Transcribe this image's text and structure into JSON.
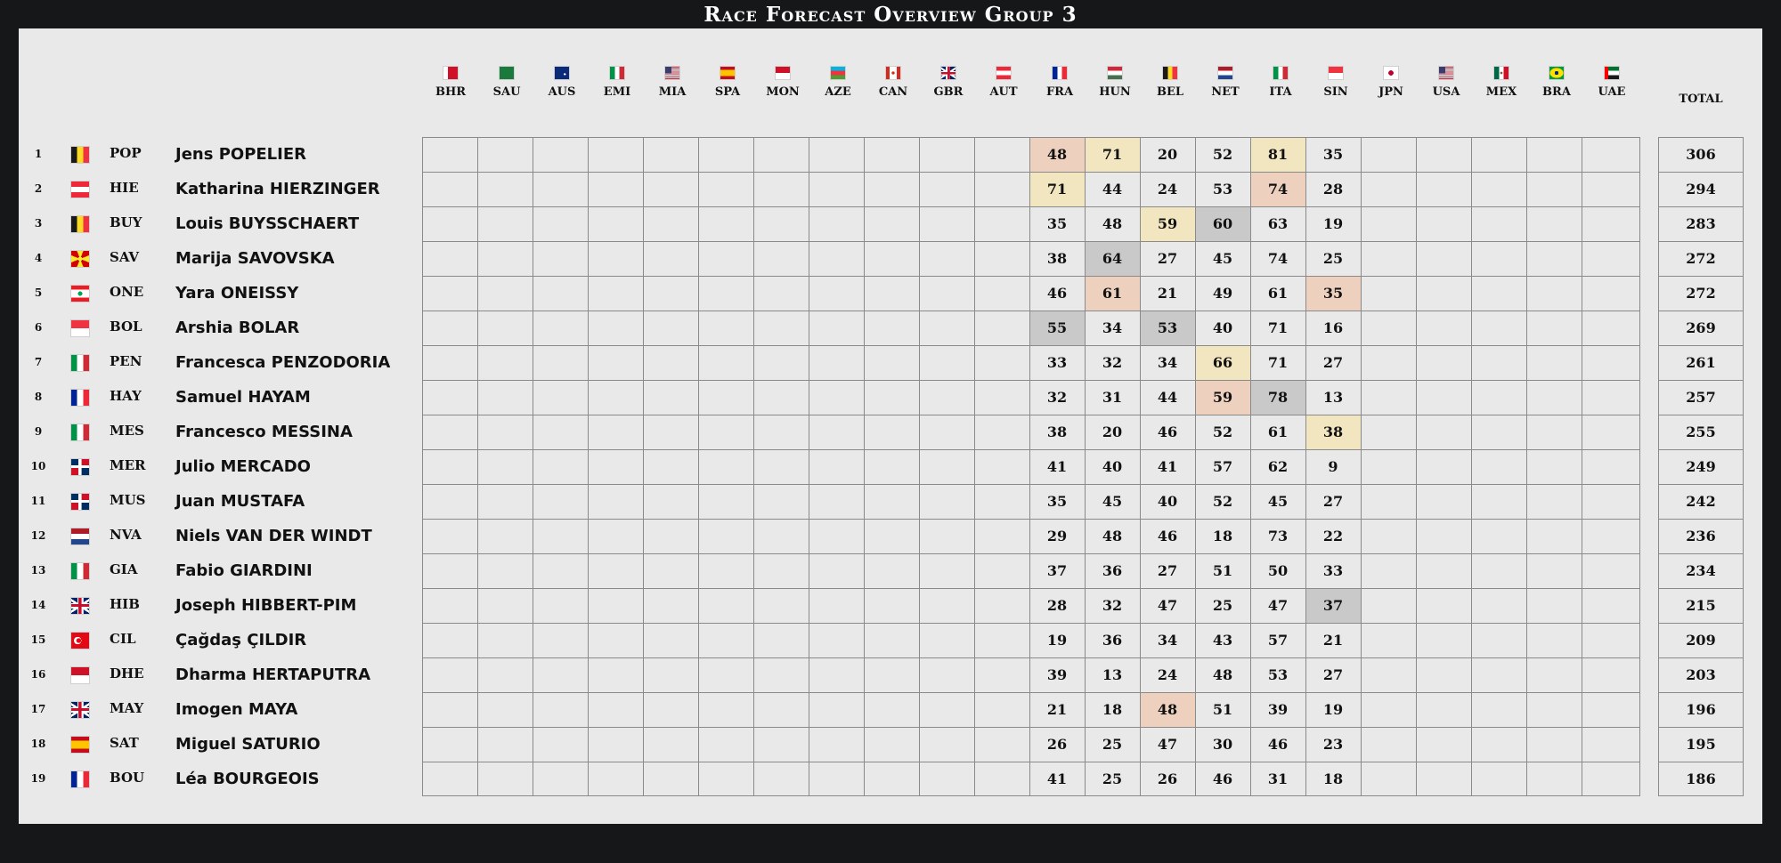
{
  "title": "Race Forecast Overview Group 3",
  "total_label": "TOTAL",
  "races": [
    {
      "code": "BHR",
      "flag": "bahrain"
    },
    {
      "code": "SAU",
      "flag": "saudi-arabia"
    },
    {
      "code": "AUS",
      "flag": "australia"
    },
    {
      "code": "EMI",
      "flag": "italy"
    },
    {
      "code": "MIA",
      "flag": "usa"
    },
    {
      "code": "SPA",
      "flag": "spain"
    },
    {
      "code": "MON",
      "flag": "monaco"
    },
    {
      "code": "AZE",
      "flag": "azerbaijan"
    },
    {
      "code": "CAN",
      "flag": "canada"
    },
    {
      "code": "GBR",
      "flag": "uk"
    },
    {
      "code": "AUT",
      "flag": "austria"
    },
    {
      "code": "FRA",
      "flag": "france"
    },
    {
      "code": "HUN",
      "flag": "hungary"
    },
    {
      "code": "BEL",
      "flag": "belgium"
    },
    {
      "code": "NET",
      "flag": "netherlands"
    },
    {
      "code": "ITA",
      "flag": "italy"
    },
    {
      "code": "SIN",
      "flag": "singapore"
    },
    {
      "code": "JPN",
      "flag": "japan"
    },
    {
      "code": "USA",
      "flag": "usa"
    },
    {
      "code": "MEX",
      "flag": "mexico"
    },
    {
      "code": "BRA",
      "flag": "brazil"
    },
    {
      "code": "UAE",
      "flag": "uae"
    }
  ],
  "highlight_colors": {
    "yellow": "#f2e6c0",
    "peach": "#edd1be",
    "grey": "#c9c9c9"
  },
  "players": [
    {
      "rank": "1",
      "flag": "belgium",
      "code": "POP",
      "name": "Jens POPELIER",
      "scores": [
        "48",
        "71",
        "20",
        "52",
        "81",
        "35"
      ],
      "highlights": [
        "peach",
        "yellow",
        "",
        "",
        "yellow",
        ""
      ],
      "total": "306"
    },
    {
      "rank": "2",
      "flag": "austria",
      "code": "HIE",
      "name": "Katharina HIERZINGER",
      "scores": [
        "71",
        "44",
        "24",
        "53",
        "74",
        "28"
      ],
      "highlights": [
        "yellow",
        "",
        "",
        "",
        "peach",
        ""
      ],
      "total": "294"
    },
    {
      "rank": "3",
      "flag": "belgium",
      "code": "BUY",
      "name": "Louis BUYSSCHAERT",
      "scores": [
        "35",
        "48",
        "59",
        "60",
        "63",
        "19"
      ],
      "highlights": [
        "",
        "",
        "yellow",
        "grey",
        "",
        ""
      ],
      "total": "283"
    },
    {
      "rank": "4",
      "flag": "macedonia",
      "code": "SAV",
      "name": "Marija SAVOVSKA",
      "scores": [
        "38",
        "64",
        "27",
        "45",
        "74",
        "25"
      ],
      "highlights": [
        "",
        "grey",
        "",
        "",
        "",
        ""
      ],
      "total": "272"
    },
    {
      "rank": "5",
      "flag": "lebanon",
      "code": "ONE",
      "name": "Yara ONEISSY",
      "scores": [
        "46",
        "61",
        "21",
        "49",
        "61",
        "35"
      ],
      "highlights": [
        "",
        "peach",
        "",
        "",
        "",
        "peach"
      ],
      "total": "272"
    },
    {
      "rank": "6",
      "flag": "singapore",
      "code": "BOL",
      "name": "Arshia BOLAR",
      "scores": [
        "55",
        "34",
        "53",
        "40",
        "71",
        "16"
      ],
      "highlights": [
        "grey",
        "",
        "grey",
        "",
        "",
        ""
      ],
      "total": "269"
    },
    {
      "rank": "7",
      "flag": "italy",
      "code": "PEN",
      "name": "Francesca PENZODORIA",
      "scores": [
        "33",
        "32",
        "34",
        "66",
        "71",
        "27"
      ],
      "highlights": [
        "",
        "",
        "",
        "yellow",
        "",
        ""
      ],
      "total": "261"
    },
    {
      "rank": "8",
      "flag": "france",
      "code": "HAY",
      "name": "Samuel HAYAM",
      "scores": [
        "32",
        "31",
        "44",
        "59",
        "78",
        "13"
      ],
      "highlights": [
        "",
        "",
        "",
        "peach",
        "grey",
        ""
      ],
      "total": "257"
    },
    {
      "rank": "9",
      "flag": "italy",
      "code": "MES",
      "name": "Francesco MESSINA",
      "scores": [
        "38",
        "20",
        "46",
        "52",
        "61",
        "38"
      ],
      "highlights": [
        "",
        "",
        "",
        "",
        "",
        "yellow"
      ],
      "total": "255"
    },
    {
      "rank": "10",
      "flag": "dominican",
      "code": "MER",
      "name": "Julio MERCADO",
      "scores": [
        "41",
        "40",
        "41",
        "57",
        "62",
        "9"
      ],
      "highlights": [
        "",
        "",
        "",
        "",
        "",
        ""
      ],
      "total": "249"
    },
    {
      "rank": "11",
      "flag": "dominican",
      "code": "MUS",
      "name": "Juan MUSTAFA",
      "scores": [
        "35",
        "45",
        "40",
        "52",
        "45",
        "27"
      ],
      "highlights": [
        "",
        "",
        "",
        "",
        "",
        ""
      ],
      "total": "242"
    },
    {
      "rank": "12",
      "flag": "netherlands",
      "code": "NVA",
      "name": "Niels VAN DER WINDT",
      "scores": [
        "29",
        "48",
        "46",
        "18",
        "73",
        "22"
      ],
      "highlights": [
        "",
        "",
        "",
        "",
        "",
        ""
      ],
      "total": "236"
    },
    {
      "rank": "13",
      "flag": "italy",
      "code": "GIA",
      "name": "Fabio GIARDINI",
      "scores": [
        "37",
        "36",
        "27",
        "51",
        "50",
        "33"
      ],
      "highlights": [
        "",
        "",
        "",
        "",
        "",
        ""
      ],
      "total": "234"
    },
    {
      "rank": "14",
      "flag": "uk",
      "code": "HIB",
      "name": "Joseph HIBBERT-PIM",
      "scores": [
        "28",
        "32",
        "47",
        "25",
        "47",
        "37"
      ],
      "highlights": [
        "",
        "",
        "",
        "",
        "",
        "grey"
      ],
      "total": "215"
    },
    {
      "rank": "15",
      "flag": "turkey",
      "code": "CIL",
      "name": "Çağdaş ÇILDIR",
      "scores": [
        "19",
        "36",
        "34",
        "43",
        "57",
        "21"
      ],
      "highlights": [
        "",
        "",
        "",
        "",
        "",
        ""
      ],
      "total": "209"
    },
    {
      "rank": "16",
      "flag": "indonesia",
      "code": "DHE",
      "name": "Dharma HERTAPUTRA",
      "scores": [
        "39",
        "13",
        "24",
        "48",
        "53",
        "27"
      ],
      "highlights": [
        "",
        "",
        "",
        "",
        "",
        ""
      ],
      "total": "203"
    },
    {
      "rank": "17",
      "flag": "uk",
      "code": "MAY",
      "name": "Imogen MAYA",
      "scores": [
        "21",
        "18",
        "48",
        "51",
        "39",
        "19"
      ],
      "highlights": [
        "",
        "",
        "peach",
        "",
        "",
        ""
      ],
      "total": "196"
    },
    {
      "rank": "18",
      "flag": "spain",
      "code": "SAT",
      "name": "Miguel SATURIO",
      "scores": [
        "26",
        "25",
        "47",
        "30",
        "46",
        "23"
      ],
      "highlights": [
        "",
        "",
        "",
        "",
        "",
        ""
      ],
      "total": "195"
    },
    {
      "rank": "19",
      "flag": "france",
      "code": "BOU",
      "name": "Léa BOURGEOIS",
      "scores": [
        "41",
        "25",
        "26",
        "46",
        "31",
        "18"
      ],
      "highlights": [
        "",
        "",
        "",
        "",
        "",
        ""
      ],
      "total": "186"
    }
  ]
}
